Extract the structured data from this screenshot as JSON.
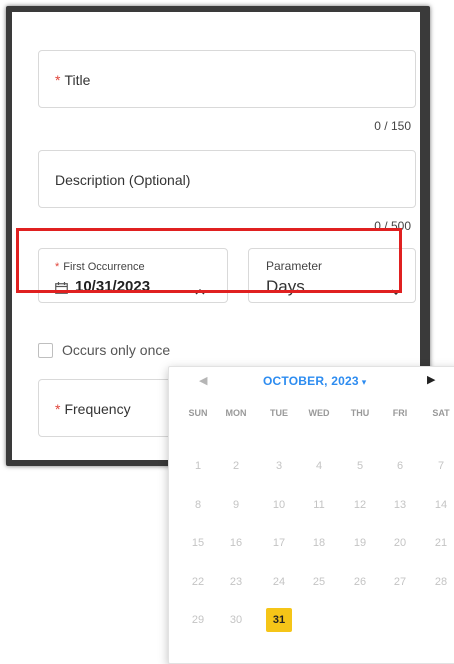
{
  "form": {
    "title_required_mark": "*",
    "title_label": "Title",
    "title_counter": "0 / 150",
    "description_label": "Description (Optional)",
    "description_counter": "0 / 500",
    "first_occurrence_required_mark": "*",
    "first_occurrence_label": "First Occurrence",
    "first_occurrence_value": "10/31/2023",
    "parameter_label": "Parameter",
    "parameter_value": "Days",
    "occurs_once_label": "Occurs only once",
    "frequency_required_mark": "*",
    "frequency_label": "Frequency"
  },
  "calendar": {
    "month_label": "OCTOBER, 2023",
    "weekdays": [
      "SUN",
      "MON",
      "TUE",
      "WED",
      "THU",
      "FRI",
      "SAT"
    ],
    "days": [
      [
        "1",
        "2",
        "3",
        "4",
        "5",
        "6",
        "7"
      ],
      [
        "8",
        "9",
        "10",
        "11",
        "12",
        "13",
        "14"
      ],
      [
        "15",
        "16",
        "17",
        "18",
        "19",
        "20",
        "21"
      ],
      [
        "22",
        "23",
        "24",
        "25",
        "26",
        "27",
        "28"
      ],
      [
        "29",
        "30",
        "31"
      ]
    ],
    "selected_day": "31"
  },
  "colors": {
    "accent_blue": "#2d8cf0",
    "selected_day": "#f5c518",
    "required_mark": "#e0443a",
    "highlight_box": "#e02020"
  },
  "icons": {
    "date": "calendar-icon",
    "first_occurrence_toggle": "chevron-up-icon",
    "parameter_toggle": "chevron-down-icon",
    "month_dropdown": "chevron-down-icon",
    "prev": "chevron-left-icon",
    "next": "chevron-right-icon"
  }
}
